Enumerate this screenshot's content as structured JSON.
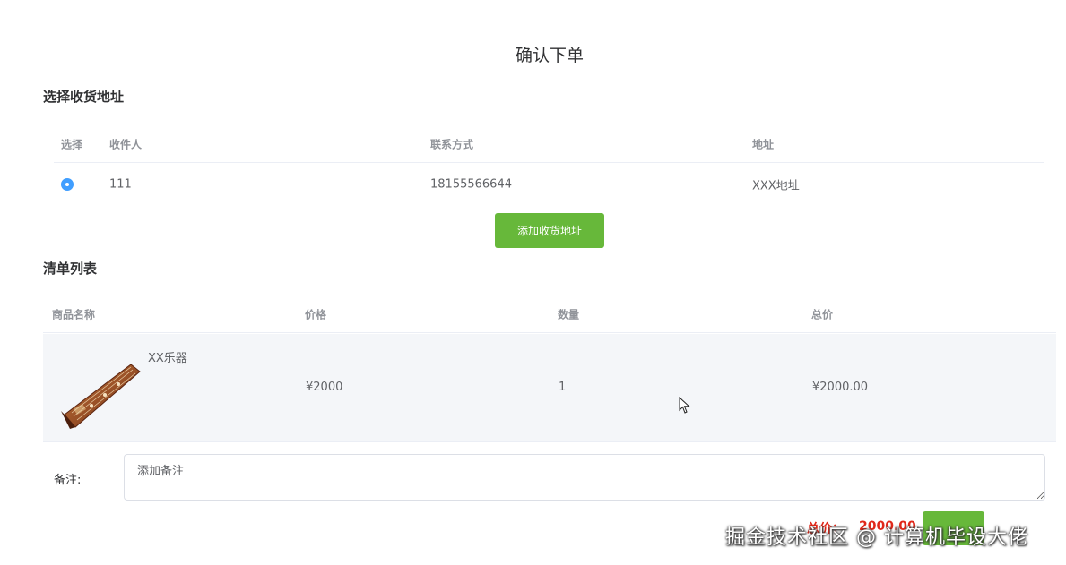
{
  "page": {
    "title": "确认下单"
  },
  "address_section": {
    "title": "选择收货地址",
    "columns": [
      "选择",
      "收件人",
      "联系方式",
      "地址"
    ],
    "rows": [
      {
        "selected": true,
        "name": "111",
        "phone": "18155566644",
        "address": "XXX地址"
      }
    ],
    "add_button": "添加收货地址"
  },
  "list_section": {
    "title": "清单列表",
    "columns": [
      "商品名称",
      "价格",
      "数量",
      "总价"
    ],
    "rows": [
      {
        "name": "XX乐器",
        "price": "¥2000",
        "quantity": "1",
        "total": "¥2000.00",
        "image_icon": "guzheng-image"
      }
    ]
  },
  "remark": {
    "label": "备注:",
    "placeholder": "添加备注"
  },
  "summary": {
    "total_label": "总价：",
    "total_value": "2000.00",
    "submit_label": ""
  },
  "watermark": "掘金技术社区 @ 计算机毕设大佬",
  "colors": {
    "primary_green": "#67b83a",
    "radio_blue": "#409eff",
    "price_red": "#e0281a"
  }
}
